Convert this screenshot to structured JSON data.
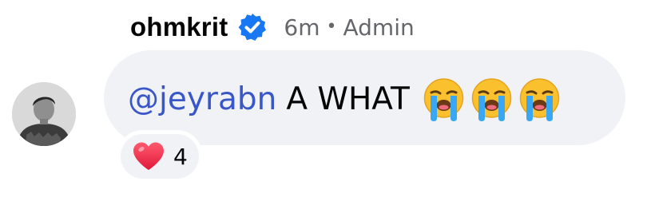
{
  "comment": {
    "author": "ohmkrit",
    "verified": true,
    "time": "6m",
    "separator": "•",
    "role": "Admin",
    "mention": "@jeyrabn",
    "text": "A WHAT",
    "emojis": [
      "loudly-crying-face",
      "loudly-crying-face",
      "loudly-crying-face"
    ],
    "reaction": {
      "type": "heart",
      "count": "4"
    }
  },
  "colors": {
    "bubble": "#f0f2f5",
    "mention": "#3a57c9",
    "meta": "#65676b",
    "verified": "#1877f2",
    "heart": "#f5334f"
  }
}
